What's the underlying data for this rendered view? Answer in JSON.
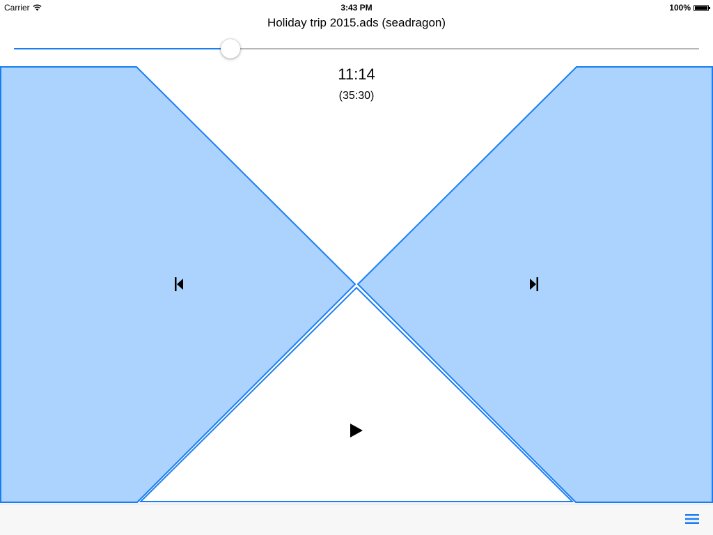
{
  "status_bar": {
    "carrier": "Carrier",
    "time": "3:43 PM",
    "battery": "100%",
    "wifi_icon": "wifi-icon",
    "battery_icon": "battery-icon"
  },
  "player": {
    "title": "Holiday trip 2015.ads (seadragon)",
    "elapsed": "11:14",
    "total": "(35:30)",
    "progress_fraction": 0.3164
  },
  "controls": {
    "previous_icon": "skip-previous-icon",
    "next_icon": "skip-next-icon",
    "play_icon": "play-icon"
  },
  "toolbar": {
    "menu_icon": "menu-icon"
  },
  "colors": {
    "accent": "#1a7ef2",
    "pad_fill": "#acd3fe",
    "track": "#b7b7b7",
    "toolbar_bg": "#f7f7f7"
  }
}
